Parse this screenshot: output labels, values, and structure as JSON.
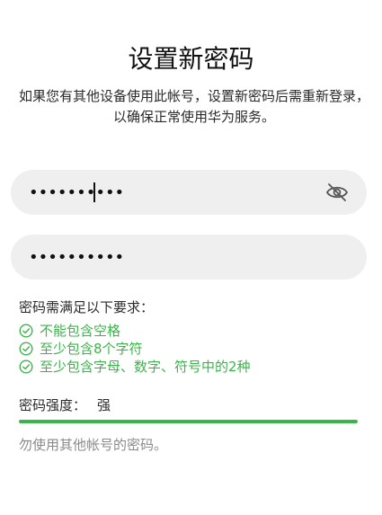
{
  "header": {
    "title": "设置新密码",
    "description": "如果您有其他设备使用此帐号，设置新密码后需重新登录，以确保正常使用华为服务。"
  },
  "form": {
    "new_password": {
      "value": "••••••••••",
      "visibility_icon": "eye-off-icon"
    },
    "confirm_password": {
      "value": "••••••••••"
    }
  },
  "requirements": {
    "title": "密码需满足以下要求：",
    "items": [
      {
        "label": "不能包含空格",
        "icon": "check-circle-icon"
      },
      {
        "label": "至少包含8个字符",
        "icon": "check-circle-icon"
      },
      {
        "label": "至少包含字母、数字、符号中的2种",
        "icon": "check-circle-icon"
      }
    ]
  },
  "strength": {
    "label": "密码强度：",
    "value": "强",
    "level": 1.0
  },
  "hint": "勿使用其他帐号的密码。",
  "colors": {
    "accent_green": "#3bb54a",
    "field_background": "#efefef",
    "text_primary": "#111111",
    "text_secondary": "#8a8a8a"
  }
}
